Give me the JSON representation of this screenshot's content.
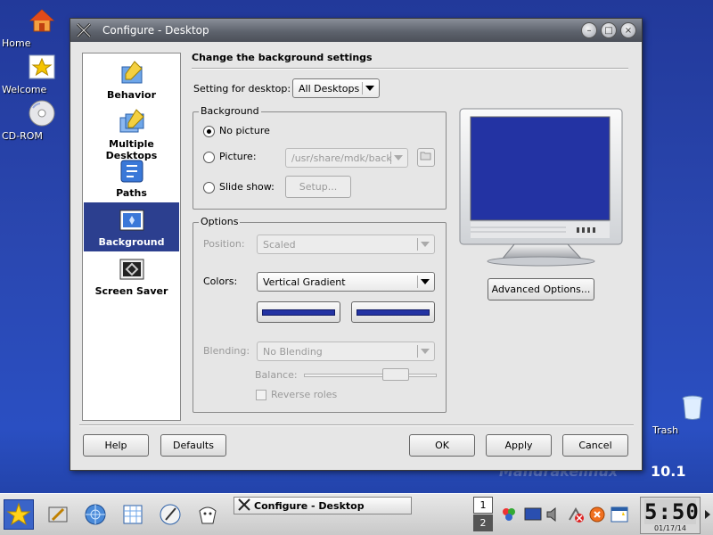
{
  "desktop": {
    "icons": [
      {
        "label": "Home"
      },
      {
        "label": "Welcome"
      },
      {
        "label": "CD-ROM"
      },
      {
        "label": "Trash"
      }
    ],
    "brand": "10.1",
    "brand_faded": "Mandrakelinux"
  },
  "window": {
    "title": "Configure - Desktop",
    "controls": {
      "minimize": "–",
      "maximize": "□",
      "close": "×"
    }
  },
  "sidebar": {
    "items": [
      {
        "label": "Behavior",
        "icon": "behavior-icon"
      },
      {
        "label": "Multiple Desktops",
        "icon": "multiple-desktops-icon"
      },
      {
        "label": "Paths",
        "icon": "paths-icon"
      },
      {
        "label": "Background",
        "icon": "background-icon",
        "active": true
      },
      {
        "label": "Screen Saver",
        "icon": "screen-saver-icon"
      }
    ]
  },
  "main": {
    "heading": "Change the background settings",
    "setting_for_desktop_label": "Setting for desktop:",
    "setting_for_desktop_value": "All Desktops",
    "background_group": {
      "title": "Background",
      "no_picture": "No picture",
      "picture": "Picture:",
      "picture_path": "/usr/share/mdk/back",
      "slide_show": "Slide show:",
      "setup": "Setup...",
      "selected": "no_picture"
    },
    "options_group": {
      "title": "Options",
      "position_label": "Position:",
      "position_value": "Scaled",
      "colors_label": "Colors:",
      "colors_value": "Vertical Gradient",
      "color1": "#2333a3",
      "color2": "#2333a3",
      "blending_label": "Blending:",
      "blending_value": "No Blending",
      "balance_label": "Balance:",
      "reverse_roles": "Reverse roles"
    },
    "advanced_options": "Advanced Options..."
  },
  "buttons": {
    "help": "Help",
    "defaults": "Defaults",
    "ok": "OK",
    "apply": "Apply",
    "cancel": "Cancel"
  },
  "taskbar": {
    "task_title": "Configure - Desktop",
    "pager": [
      "1",
      "2"
    ],
    "clock_time": "5:50",
    "clock_date": "01/17/14"
  },
  "colors": {
    "desktop_blue": "#2a47b0",
    "selection_blue": "#2c3f8f",
    "preview_blue": "#2333a3"
  }
}
